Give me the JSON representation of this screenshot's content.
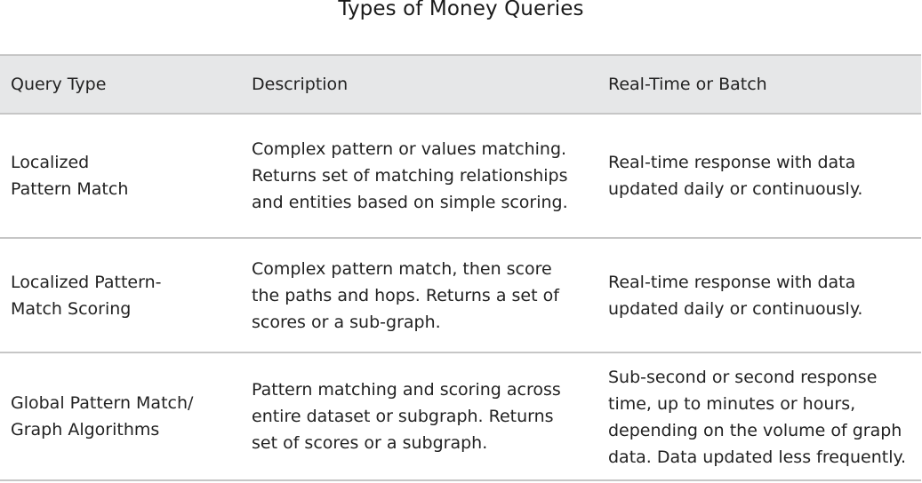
{
  "title": "Types of Money Queries",
  "table": {
    "headers": [
      "Query Type",
      "Description",
      "Real-Time or Batch"
    ],
    "rows": [
      {
        "query_type": "Localized\nPattern Match",
        "description": "Complex pattern or values matching.\nReturns set of matching relationships\nand entities based on simple scoring.",
        "timing": "Real-time response with data\nupdated daily or continuously."
      },
      {
        "query_type": "Localized Pattern-\nMatch Scoring",
        "description": "Complex pattern match, then score\nthe paths and hops. Returns a set of\nscores or a sub-graph.",
        "timing": "Real-time response with data\nupdated daily or continuously."
      },
      {
        "query_type": "Global Pattern Match/\nGraph Algorithms",
        "description": "Pattern matching and scoring across\nentire dataset or subgraph. Returns\nset of scores or a subgraph.",
        "timing": "Sub-second or second response\ntime, up to minutes or hours,\ndepending on the volume of graph\ndata. Data updated less frequently."
      }
    ]
  },
  "colors": {
    "header_bg": "#e6e7e8",
    "border": "#c6c6c6",
    "text": "#222222"
  }
}
